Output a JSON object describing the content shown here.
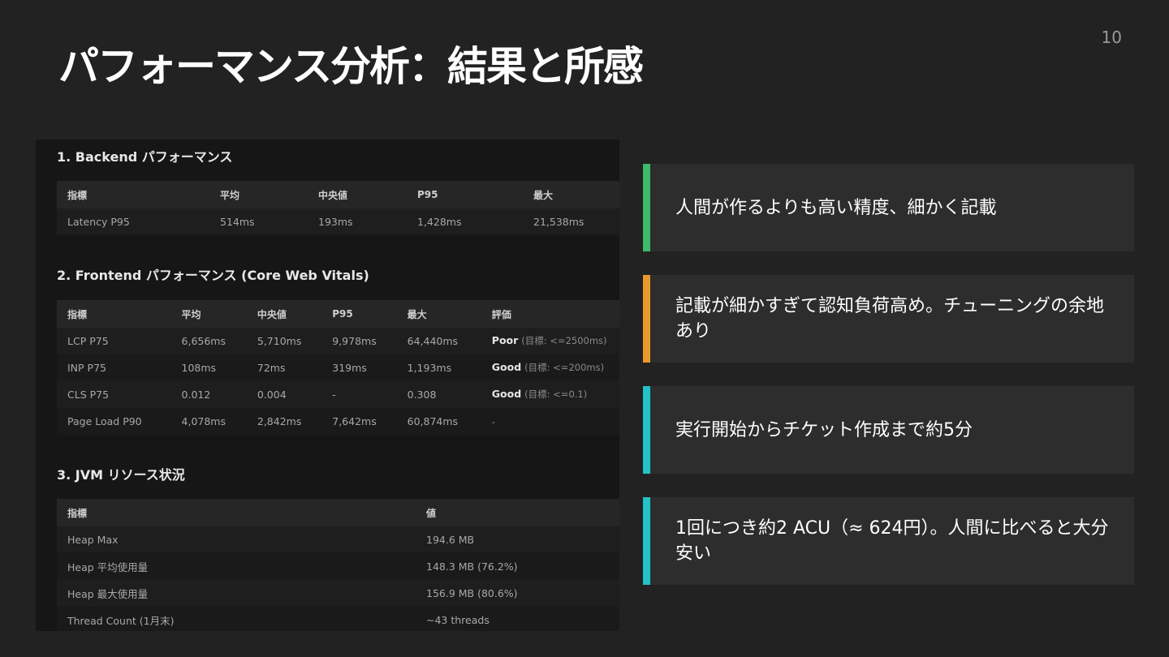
{
  "slide": {
    "title": "パフォーマンス分析：結果と所感",
    "page_number": "10"
  },
  "report": {
    "backend": {
      "heading": "1. Backend パフォーマンス",
      "headers": [
        "指標",
        "平均",
        "中央値",
        "P95",
        "最大"
      ],
      "rows": [
        [
          "Latency P95",
          "514ms",
          "193ms",
          "1,428ms",
          "21,538ms"
        ]
      ]
    },
    "frontend": {
      "heading": "2. Frontend パフォーマンス (Core Web Vitals)",
      "headers": [
        "指標",
        "平均",
        "中央値",
        "P95",
        "最大",
        "評価"
      ],
      "rows": [
        {
          "metric": "LCP P75",
          "avg": "6,656ms",
          "median": "5,710ms",
          "p95": "9,978ms",
          "max": "64,440ms",
          "rating": "Poor",
          "target": "(目標: <=2500ms)"
        },
        {
          "metric": "INP P75",
          "avg": "108ms",
          "median": "72ms",
          "p95": "319ms",
          "max": "1,193ms",
          "rating": "Good",
          "target": "(目標: <=200ms)"
        },
        {
          "metric": "CLS P75",
          "avg": "0.012",
          "median": "0.004",
          "p95": "-",
          "max": "0.308",
          "rating": "Good",
          "target": "(目標: <=0.1)"
        },
        {
          "metric": "Page Load P90",
          "avg": "4,078ms",
          "median": "2,842ms",
          "p95": "7,642ms",
          "max": "60,874ms",
          "rating": "-",
          "target": ""
        }
      ]
    },
    "jvm": {
      "heading": "3. JVM リソース状況",
      "headers": [
        "指標",
        "値"
      ],
      "rows": [
        [
          "Heap Max",
          "194.6 MB"
        ],
        [
          "Heap 平均使用量",
          "148.3 MB (76.2%)"
        ],
        [
          "Heap 最大使用量",
          "156.9 MB (80.6%)"
        ],
        [
          "Thread Count (1月末)",
          "~43 threads"
        ]
      ]
    }
  },
  "findings": [
    {
      "text": "人間が作るよりも高い精度、細かく記載",
      "accent": "#3dba6a"
    },
    {
      "text": "記載が細かすぎて認知負荷高め。チューニングの余地あり",
      "accent": "#e89a2c"
    },
    {
      "text": "実行開始からチケット作成まで約5分",
      "accent": "#1fc3c8"
    },
    {
      "text": "1回につき約2 ACU（≈ 624円）。人間に比べると大分安い",
      "accent": "#1fc3c8"
    }
  ]
}
